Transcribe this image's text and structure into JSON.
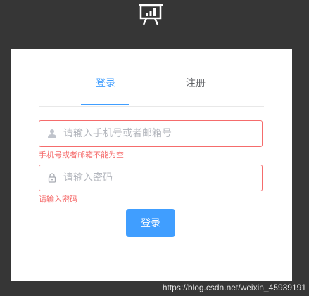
{
  "tabs": [
    {
      "label": "登录",
      "active": true
    },
    {
      "label": "注册",
      "active": false
    }
  ],
  "form": {
    "account_placeholder": "请输入手机号或者邮箱号",
    "account_error": "手机号或者邮箱不能为空",
    "password_placeholder": "请输入密码",
    "password_error": "请输入密码",
    "submit_label": "登录"
  },
  "watermark": "https://blog.csdn.net/weixin_45939191",
  "colors": {
    "background": "#363636",
    "accent": "#409eff",
    "error": "#f56c6c"
  },
  "icons": {
    "logo": "presentation-chart-icon",
    "account": "user-icon",
    "password": "lock-icon"
  }
}
